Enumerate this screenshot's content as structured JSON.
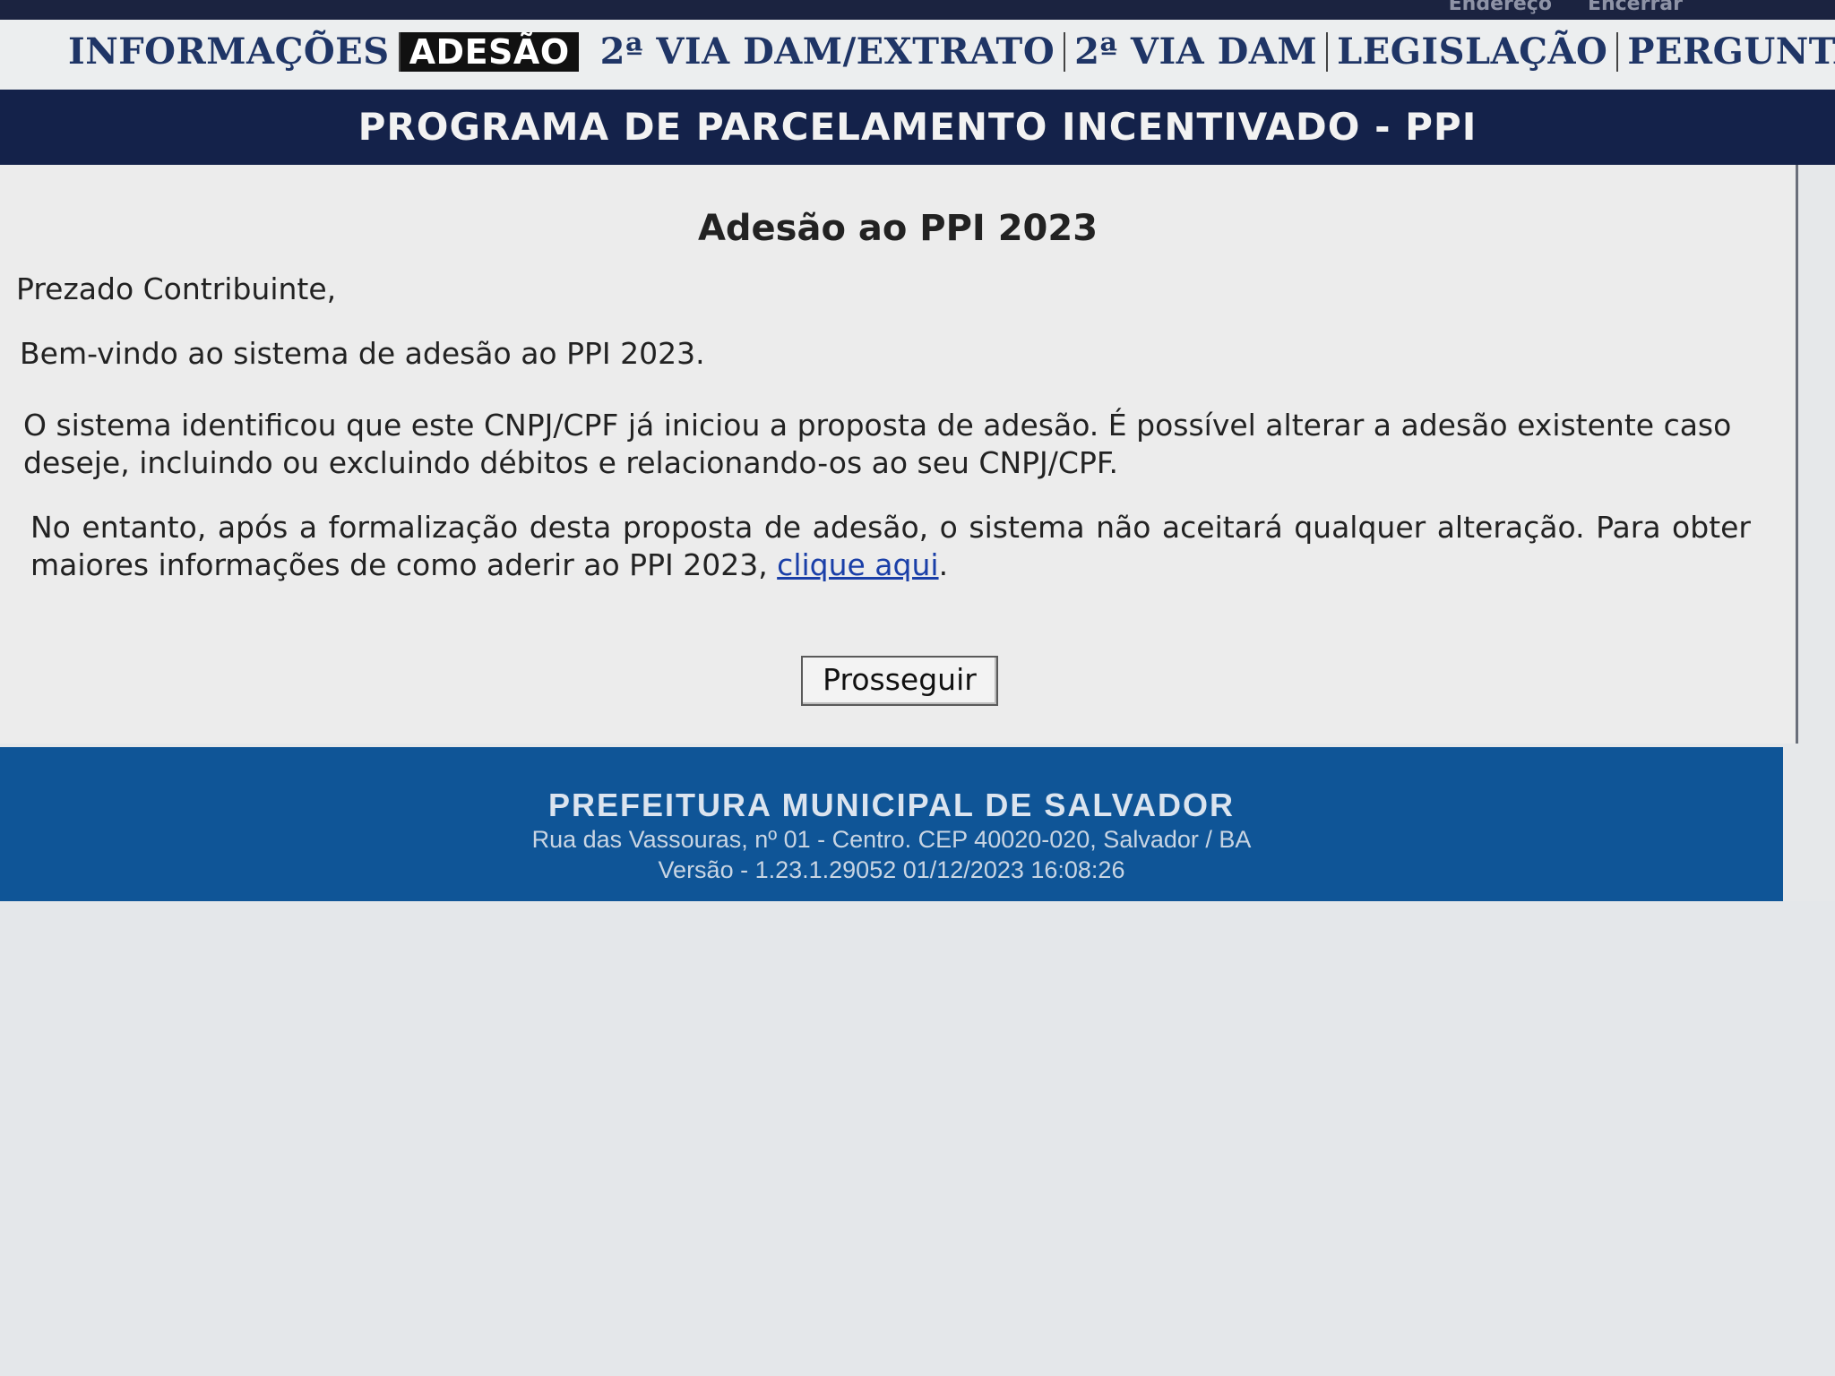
{
  "top_links": [
    "Endereço",
    "Encerrar"
  ],
  "nav": {
    "items": [
      {
        "label": "INFORMAÇÕES"
      },
      {
        "label": "ADESÃO"
      },
      {
        "label": "2ª VIA DAM/EXTRATO"
      },
      {
        "label": "2ª VIA DAM"
      },
      {
        "label": "LEGISLAÇÃO"
      },
      {
        "label": "PERGUNTAS"
      }
    ],
    "active_index": 1
  },
  "banner": {
    "title": "PROGRAMA DE PARCELAMENTO INCENTIVADO - PPI"
  },
  "main": {
    "title": "Adesão ao PPI 2023",
    "greeting": "Prezado Contribuinte,",
    "welcome": "Bem-vindo ao sistema de adesão ao PPI 2023.",
    "info": "O sistema identificou que este CNPJ/CPF já iniciou a proposta de adesão. É possível alterar a adesão existente caso deseje, incluindo ou excluindo débitos e relacionando-os ao seu CNPJ/CPF.",
    "warning_prefix": "No entanto, após a formalização desta proposta de adesão, o sistema não aceitará qualquer alteração. Para obter maiores informações de como aderir ao PPI 2023, ",
    "warning_link": "clique aqui",
    "warning_suffix": ".",
    "proceed_button": "Prosseguir"
  },
  "footer": {
    "org": "PREFEITURA MUNICIPAL DE SALVADOR",
    "address": "Rua das Vassouras, nº 01 - Centro. CEP 40020-020, Salvador / BA",
    "version": "Versão - 1.23.1.29052 01/12/2023 16:08:26"
  },
  "colors": {
    "nav_text": "#1f3566",
    "banner_bg": "#14224a",
    "footer_bg": "#0f5597",
    "link": "#1a3fa8"
  }
}
